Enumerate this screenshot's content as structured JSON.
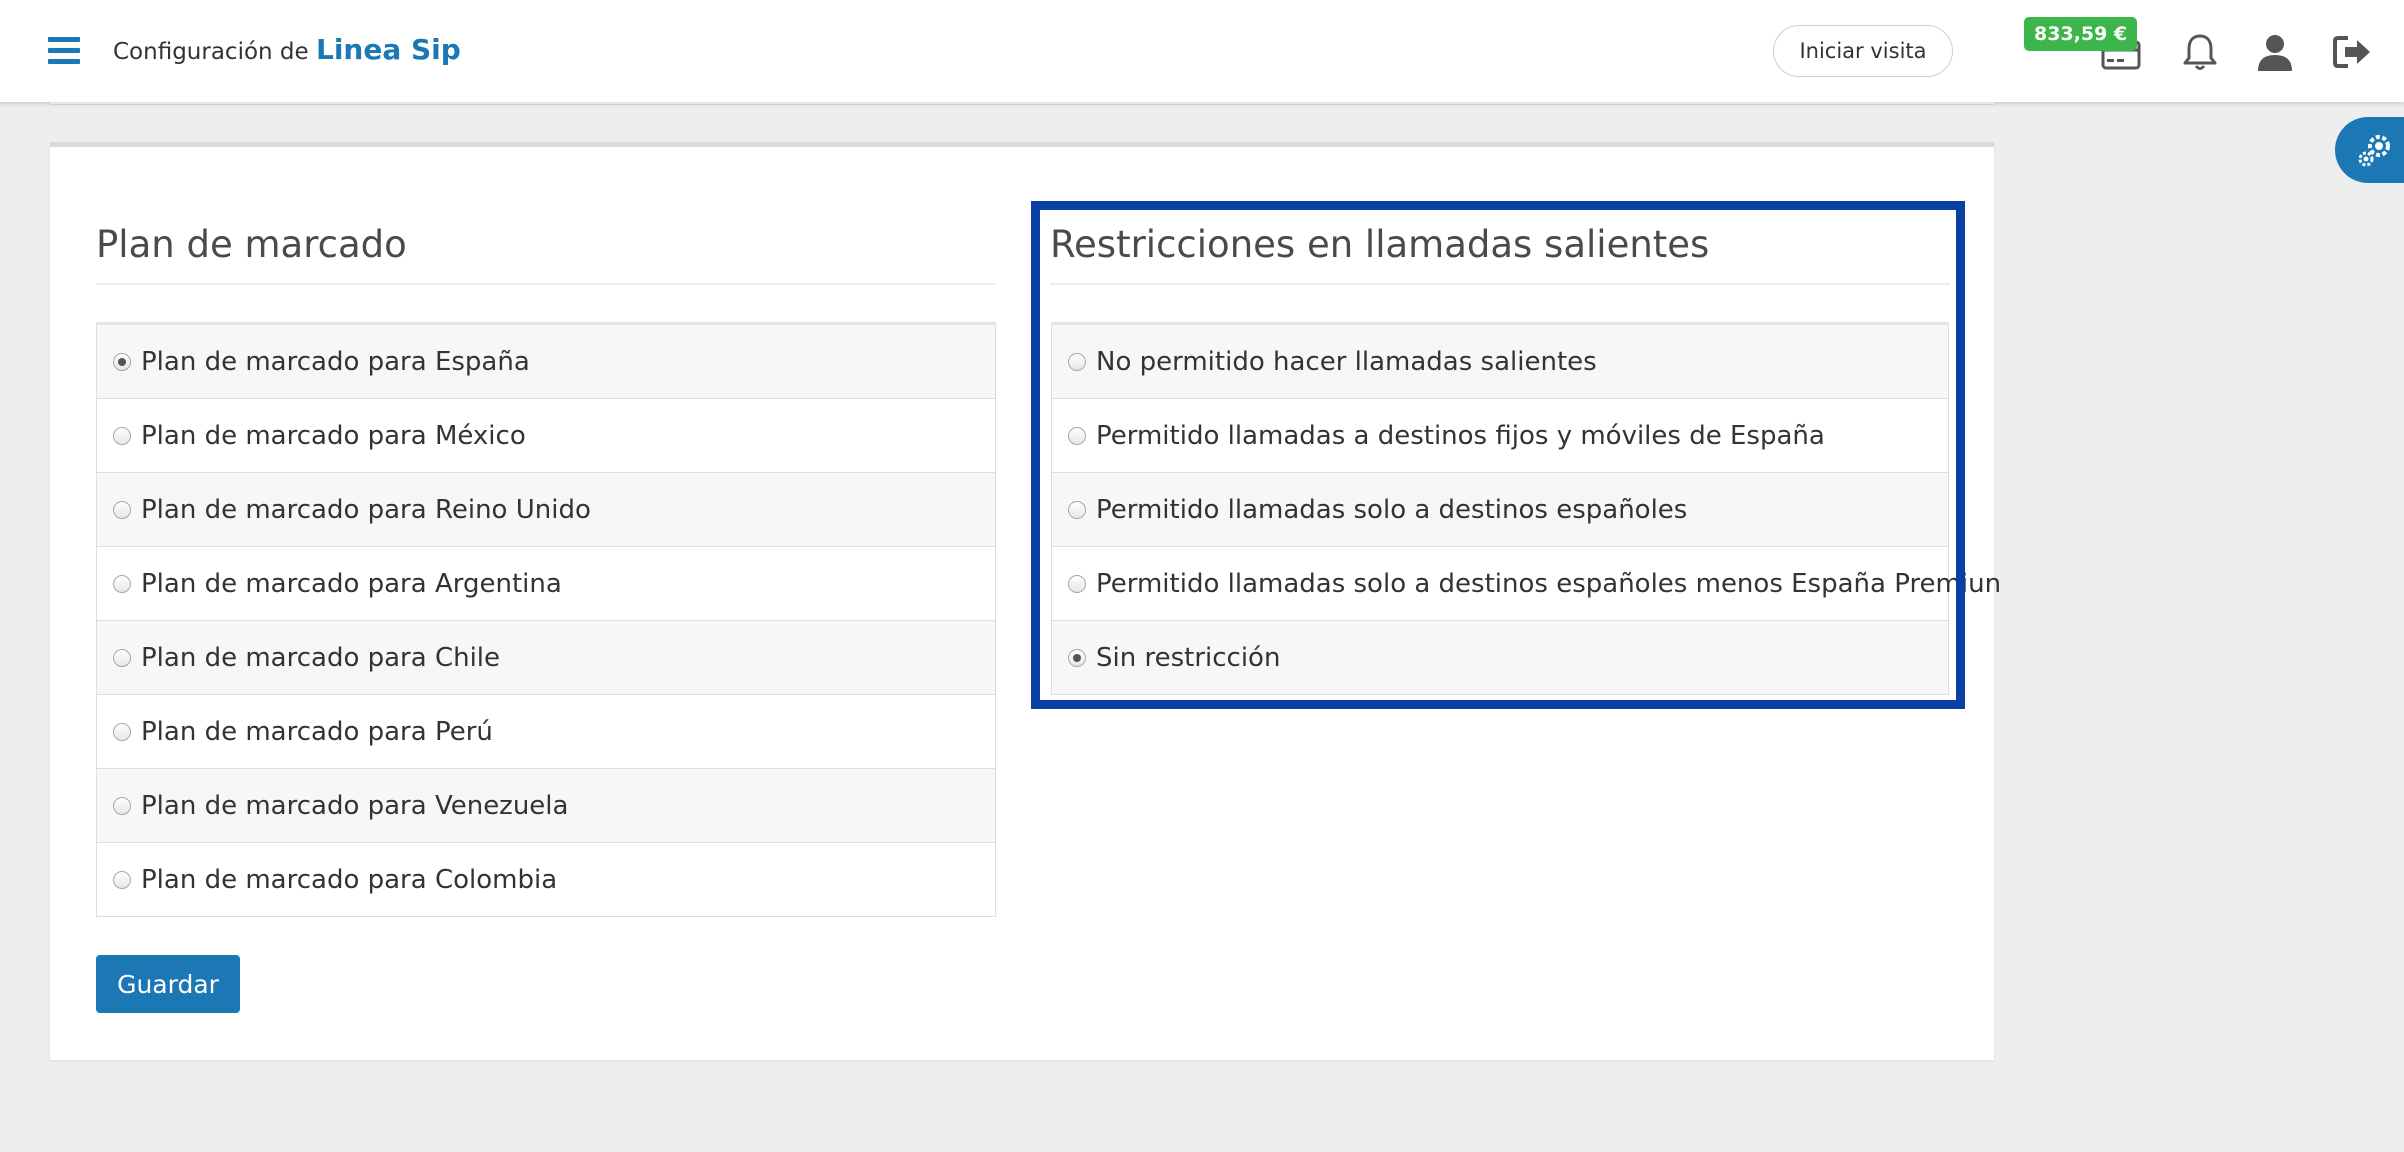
{
  "header": {
    "title_prefix": "Configuración de",
    "title_brand": "Linea Sip",
    "visit_button": "Iniciar visita",
    "credit": "833,59 €",
    "icons": [
      "menu-icon",
      "wallet-icon",
      "bell-icon",
      "user-icon",
      "logout-icon"
    ]
  },
  "colors": {
    "accent": "#1b78b4",
    "credit_badge": "#3cb54a",
    "highlight": "#0a3fa3"
  },
  "dial_plan": {
    "title": "Plan de marcado",
    "options": [
      {
        "label": "Plan de marcado para España",
        "checked": true
      },
      {
        "label": "Plan de marcado para México",
        "checked": false
      },
      {
        "label": "Plan de marcado para Reino Unido",
        "checked": false
      },
      {
        "label": "Plan de marcado para Argentina",
        "checked": false
      },
      {
        "label": "Plan de marcado para Chile",
        "checked": false
      },
      {
        "label": "Plan de marcado para Perú",
        "checked": false
      },
      {
        "label": "Plan de marcado para Venezuela",
        "checked": false
      },
      {
        "label": "Plan de marcado para Colombia",
        "checked": false
      }
    ]
  },
  "restrictions": {
    "title": "Restricciones en llamadas salientes",
    "options": [
      {
        "label": "No permitido hacer llamadas salientes",
        "checked": false
      },
      {
        "label": "Permitido llamadas a destinos fijos y móviles de España",
        "checked": false
      },
      {
        "label": "Permitido llamadas solo a destinos españoles",
        "checked": false
      },
      {
        "label": "Permitido llamadas solo a destinos españoles menos España Premiun",
        "checked": false
      },
      {
        "label": "Sin restricción",
        "checked": true
      }
    ]
  },
  "actions": {
    "save_label": "Guardar"
  }
}
